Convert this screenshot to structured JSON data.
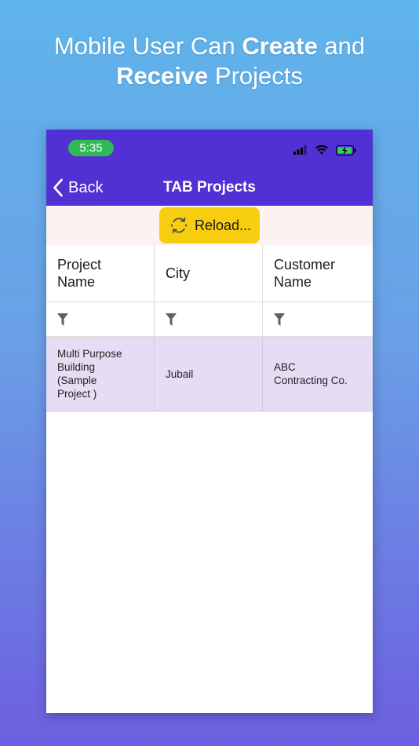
{
  "headline": {
    "line1_plain": "Mobile User Can ",
    "line1_bold": "Create",
    "line1_end": " and",
    "line2_bold": "Receive",
    "line2_end": " Projects"
  },
  "status_bar": {
    "time": "5:35"
  },
  "nav": {
    "back_label": "Back",
    "title": "TAB Projects"
  },
  "toolbar": {
    "reload_label": "Reload..."
  },
  "table": {
    "columns": [
      "Project\nName",
      "City",
      "Customer\nName"
    ],
    "rows": [
      [
        "Multi Purpose\nBuilding\n(Sample\nProject )",
        "Jubail",
        "ABC\nContracting Co."
      ]
    ]
  },
  "colors": {
    "nav_bg": "#5130d4",
    "time_pill": "#2fba55",
    "reload_btn": "#f7cd10",
    "row_highlight": "#e6ddf5"
  },
  "icons": [
    "chevron-left-icon",
    "refresh-icon",
    "filter-icon",
    "signal-icon",
    "wifi-icon",
    "battery-charging-icon"
  ]
}
